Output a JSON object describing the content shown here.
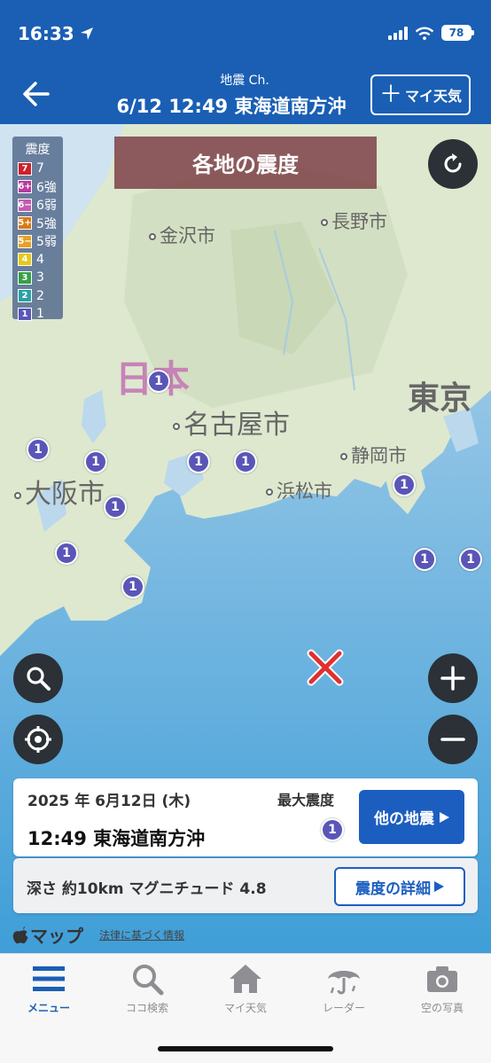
{
  "status_bar": {
    "time": "16:33",
    "battery": "78"
  },
  "header": {
    "subtitle": "地震 Ch.",
    "title": "6/12 12:49 東海道南方沖",
    "my_weather_label": "マイ天気",
    "background_color": "#1a5fb4"
  },
  "map": {
    "banner": "各地の震度",
    "legend": {
      "title": "震度",
      "items": [
        {
          "badge": "7",
          "label": "7",
          "color": "#d0202a"
        },
        {
          "badge": "6+",
          "label": "6強",
          "color": "#b83a9e"
        },
        {
          "badge": "6−",
          "label": "6弱",
          "color": "#c45bb0"
        },
        {
          "badge": "5+",
          "label": "5強",
          "color": "#d97a12"
        },
        {
          "badge": "5−",
          "label": "5弱",
          "color": "#e8a023"
        },
        {
          "badge": "4",
          "label": "4",
          "color": "#e6c818"
        },
        {
          "badge": "3",
          "label": "3",
          "color": "#36a046"
        },
        {
          "badge": "2",
          "label": "2",
          "color": "#2aa0a8"
        },
        {
          "badge": "1",
          "label": "1",
          "color": "#5a56b8"
        }
      ]
    },
    "cities": {
      "kanazawa": "金沢市",
      "nagano": "長野市",
      "nagoya": "名古屋市",
      "shizuoka": "静岡市",
      "hamamatsu": "浜松市",
      "osaka": "大阪市",
      "tokyo": "東京"
    },
    "country_label": "日本",
    "intensity_markers": [
      "1",
      "1",
      "1",
      "1",
      "1",
      "1",
      "1",
      "1",
      "1",
      "1",
      "1"
    ],
    "epicenter_icon": "epicenter-x-icon"
  },
  "info_card": {
    "date": "2025 年 6月12日 (木)",
    "max_intensity_label": "最大震度",
    "max_intensity": "1",
    "time_place": "12:49 東海道南方沖",
    "other_quakes_label": "他の地震",
    "depth_magnitude": "深さ 約10km マグニチュード 4.8",
    "detail_label": "震度の詳細"
  },
  "attribution": {
    "maps": "マップ",
    "legal": "法律に基づく情報"
  },
  "tabbar": {
    "tabs": [
      {
        "label": "メニュー",
        "icon": "menu-icon",
        "active": true
      },
      {
        "label": "ココ検索",
        "icon": "search-icon",
        "active": false
      },
      {
        "label": "マイ天気",
        "icon": "home-icon",
        "active": false
      },
      {
        "label": "レーダー",
        "icon": "umbrella-icon",
        "active": false
      },
      {
        "label": "空の写真",
        "icon": "camera-icon",
        "active": false
      }
    ]
  }
}
